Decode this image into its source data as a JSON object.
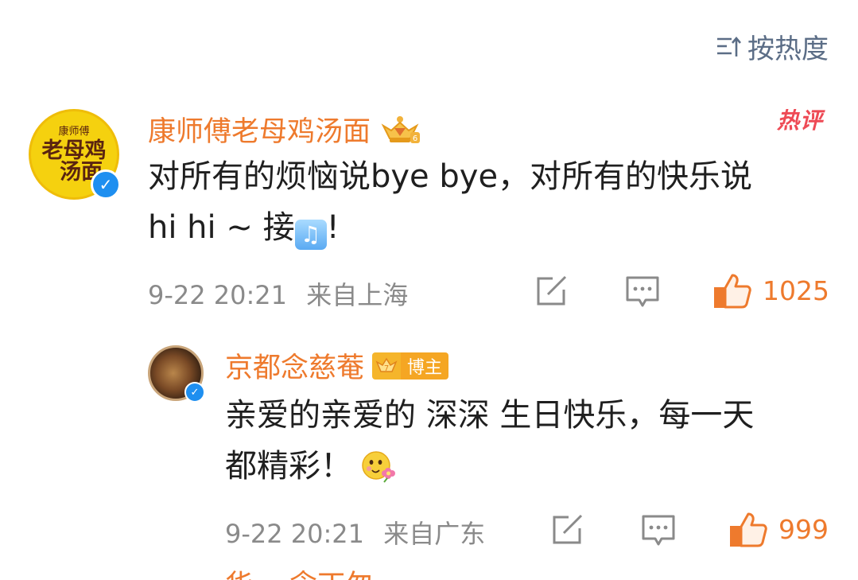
{
  "sort": {
    "label": "按热度",
    "icon": "sort-icon"
  },
  "comments": [
    {
      "author": "康师傅老母鸡汤面",
      "avatar_text": {
        "brand": "康师傅",
        "line1": "老母鸡",
        "line2": "汤面"
      },
      "verified": true,
      "badge_icon": "crown-level-6-icon",
      "hot_tag": "热评",
      "text_line1": "对所有的烦恼说bye bye，对所有的快乐说",
      "text_line2_before": "hi hi ~ 接",
      "emoji": "music-note-emoji",
      "text_line2_after": "!",
      "time": "9-22 20:21",
      "location": "来自上海",
      "likes": "1025"
    }
  ],
  "reply": {
    "author": "京都念慈菴",
    "verified": true,
    "badge_icon": "crown-level-7-icon",
    "role_tag": "博主",
    "text_line1": "亲爱的亲爱的 深深 生日快乐，每一天",
    "text_line2": "都精彩！",
    "emoji": "flower-face-emoji",
    "time": "9-22 20:21",
    "location": "来自广东",
    "likes": "999"
  },
  "partial_next": {
    "author_fragment": "华…  念丁匆"
  },
  "colors": {
    "accent_orange": "#ee7a2d",
    "text_primary": "#1f1f1f",
    "text_meta": "#8a8a8a",
    "sort_blue_gray": "#5b6d86",
    "verified_blue": "#1e8ff0",
    "hot_red": "#ee4a55"
  }
}
